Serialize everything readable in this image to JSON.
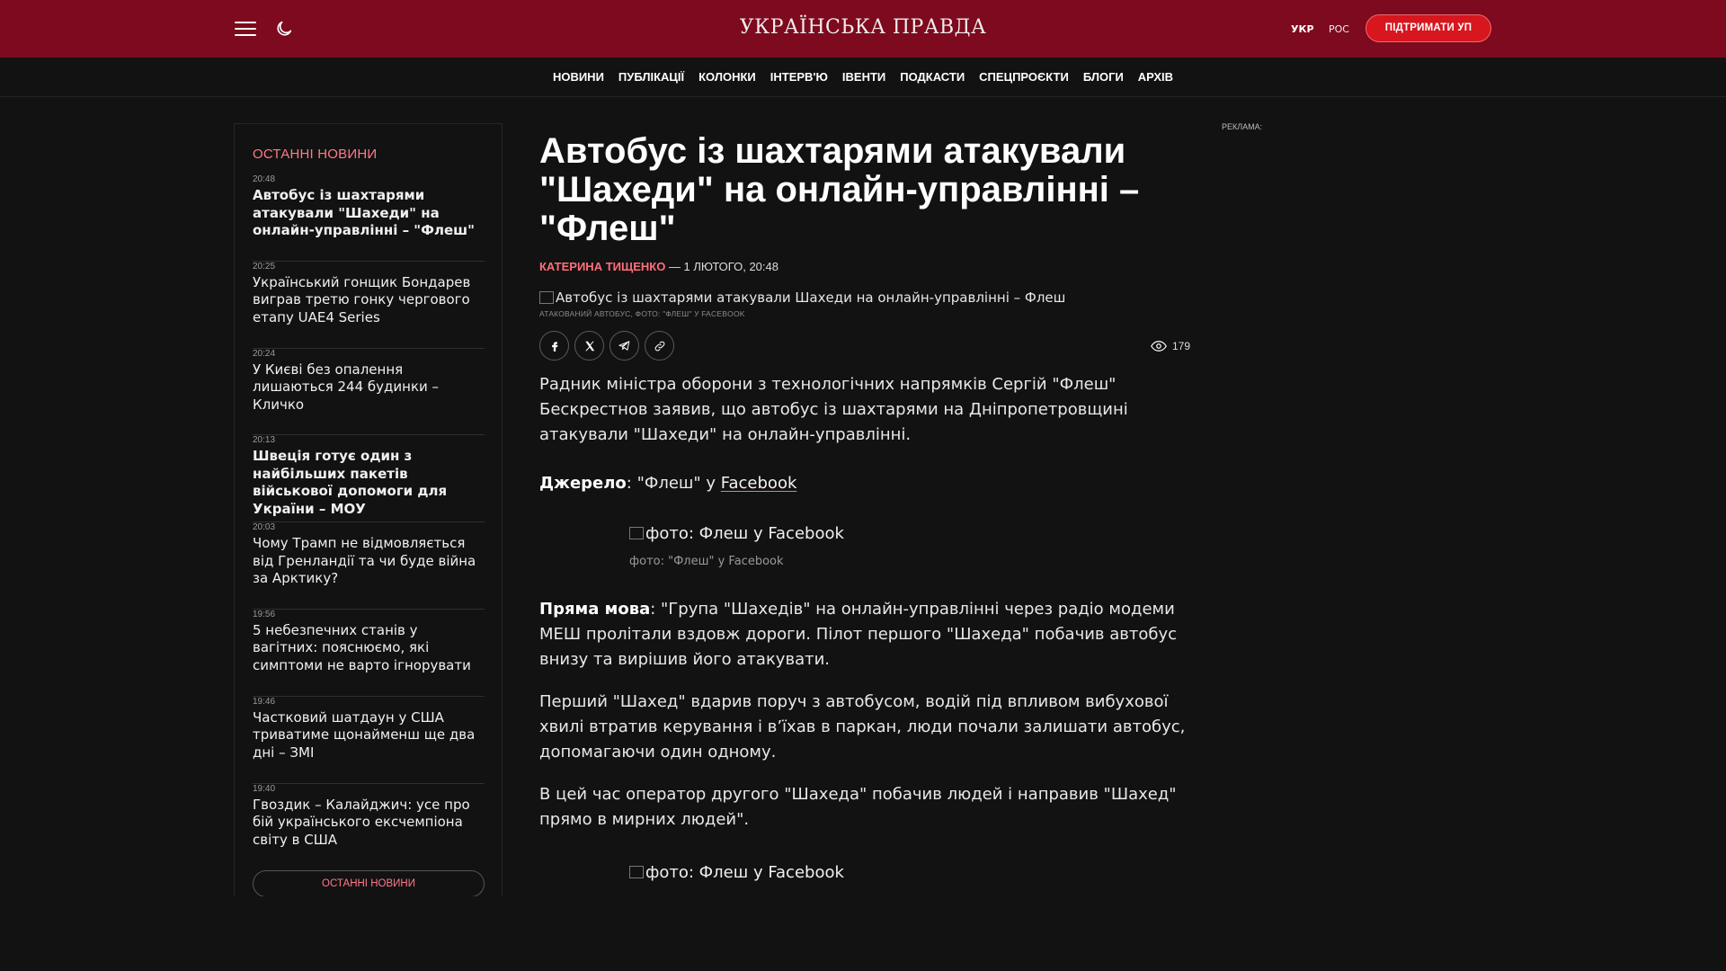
{
  "header": {
    "logo": "УКРАЇНСЬКА ПРАВДА",
    "lang_ukr": "УКР",
    "lang_ros": "РОС",
    "support_label": "ПІДТРИМАТИ УП",
    "menu_icon": "hamburger-icon",
    "theme_icon": "moon-icon"
  },
  "nav": {
    "items": [
      "НОВИНИ",
      "ПУБЛІКАЦІЇ",
      "КОЛОНКИ",
      "ІНТЕРВ'Ю",
      "ІВЕНТИ",
      "ПОДКАСТИ",
      "СПЕЦПРОЄКТИ",
      "БЛОГИ",
      "АРХІВ"
    ]
  },
  "sidebar": {
    "title": "ОСТАННІ НОВИНИ",
    "items": [
      {
        "time": "20:48",
        "headline": "Автобус із шахтарями атакували \"Шахеди\" на онлайн-управлінні – \"Флеш\""
      },
      {
        "time": "20:25",
        "headline": "Український гонщик Бондарев виграв третю гонку чергового етапу UAE4 Series"
      },
      {
        "time": "20:24",
        "headline": "У Києві без опалення лишаються 244 будинки – Кличко"
      },
      {
        "time": "20:13",
        "headline": "Швеція готує один з найбільших пакетів військової допомоги для України – МОУ"
      },
      {
        "time": "20:03",
        "headline": "Чому Трамп не відмовляється від Гренландії та чи буде війна за Арктику?"
      },
      {
        "time": "19:56",
        "headline": "5 небезпечних станів у вагітних: пояснюємо, які симптоми не варто ігнорувати"
      },
      {
        "time": "19:46",
        "headline": "Частковий шатдаун у США триватиме щонайменш ще два дні – ЗМІ"
      },
      {
        "time": "19:40",
        "headline": "Гвоздик – Калайджич: усе про бій українського ексчемпіона світу в США"
      }
    ],
    "more_label": "ОСТАННІ НОВИНИ"
  },
  "article": {
    "title": "Автобус із шахтарями атакували \"Шахеди\" на онлайн-управлінні – \"Флеш\"",
    "author": "КАТЕРИНА ТИЩЕНКО",
    "date": " — 1 ЛЮТОГО, 20:48",
    "hero_alt": "Автобус із шахтарями атакували Шахеди на онлайн-управлінні – Флеш",
    "hero_caption": "АТАКОВАНИЙ АВТОБУС, ФОТО: \"ФЛЕШ\" У FACEBOOK",
    "views": "179",
    "para1": "Радник міністра оборони з технологічних напрямків Сергій \"Флеш\" Бескрестнов заявив, що автобус із шахтарями на Дніпропетровщині атакували \"Шахеди\" на онлайн-управлінні.",
    "source_label": "Джерело",
    "source_text": ": \"Флеш\" у ",
    "source_link": "Facebook",
    "image1_alt": "фото: Флеш у Facebook",
    "image1_caption": "фото: \"Флеш\" у Facebook",
    "quote_label": "Пряма мова",
    "para2": ": \"Група \"Шахедів\" на онлайн-управлінні через радіо модеми МЕШ пролітали вздовж дороги. Пілот першого \"Шахеда\" побачив автобус внизу та вирішив його атакувати.",
    "para3": "Перший \"Шахед\" вдарив поруч з автобусом, водій під впливом вибухової хвилі втратив керування і в’їхав в паркан, люди почали залишати автобус, допомагаючи один одному.",
    "para4": "В цей час оператор другого \"Шахеда\" побачив людей і направив \"Шахед\" прямо в мирних людей\".",
    "image2_alt": "фото: Флеш у Facebook"
  },
  "ad": {
    "label": "РЕКЛАМА:"
  }
}
